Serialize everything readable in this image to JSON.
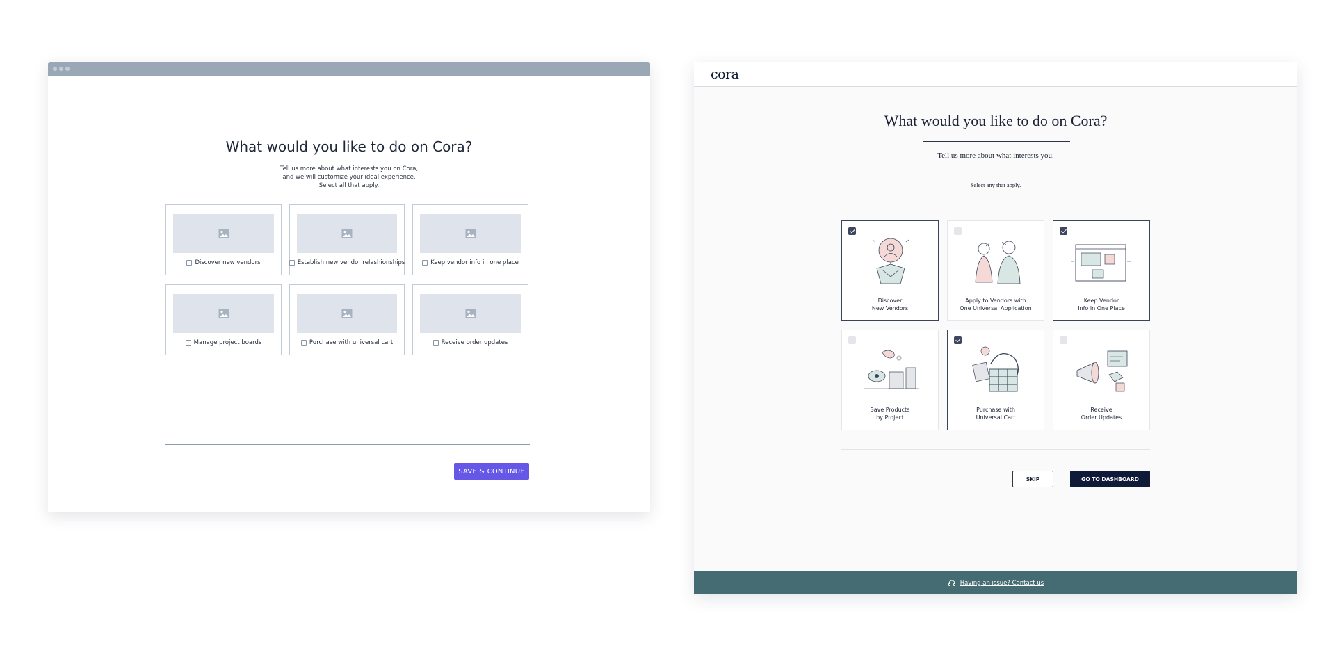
{
  "wireframe": {
    "title": "What would you like to do on Cora?",
    "subtitle_lines": [
      "Tell us more about what interests you on Cora,",
      "and we will customize your ideal experience.",
      "Select all that apply."
    ],
    "options": [
      {
        "label": "Discover new vendors",
        "icon": "image-placeholder-icon"
      },
      {
        "label": "Establish new vendor relashionships",
        "icon": "image-placeholder-icon"
      },
      {
        "label": "Keep vendor info in one place",
        "icon": "image-placeholder-icon"
      },
      {
        "label": "Manage project boards",
        "icon": "image-placeholder-icon"
      },
      {
        "label": "Purchase with universal cart",
        "icon": "image-placeholder-icon"
      },
      {
        "label": "Receive order updates",
        "icon": "image-placeholder-icon"
      }
    ],
    "save_button": "SAVE & CONTINUE",
    "colors": {
      "titlebar": "#9aa8b5",
      "button": "#6657e6",
      "placeholder": "#dfe4ec"
    }
  },
  "app": {
    "logo": "cora",
    "title": "What would you like to do on Cora?",
    "subtitle": "Tell us more about what interests you.",
    "instruction": "Select any that apply.",
    "options": [
      {
        "line1": "Discover",
        "line2": "New Vendors",
        "checked": true,
        "illustration": "vendor-discovery-illustration"
      },
      {
        "line1": "Apply to Vendors with",
        "line2": "One Universal Application",
        "checked": false,
        "illustration": "two-people-illustration"
      },
      {
        "line1": "Keep Vendor",
        "line2": "Info in One Place",
        "checked": true,
        "illustration": "browser-window-illustration"
      },
      {
        "line1": "Save Products",
        "line2": "by Project",
        "checked": false,
        "illustration": "products-board-illustration"
      },
      {
        "line1": "Purchase with",
        "line2": "Universal Cart",
        "checked": true,
        "illustration": "shopping-cart-illustration"
      },
      {
        "line1": "Receive",
        "line2": "Order Updates",
        "checked": false,
        "illustration": "megaphone-illustration"
      }
    ],
    "skip_button": "SKIP",
    "dashboard_button": "GO TO DASHBOARD",
    "footer_link": "Having an issue? Contact us",
    "footer_icon": "headset-icon",
    "colors": {
      "footer": "#456c72",
      "primary_button": "#0e1a38",
      "checkbox_on": "#3e4660"
    }
  }
}
